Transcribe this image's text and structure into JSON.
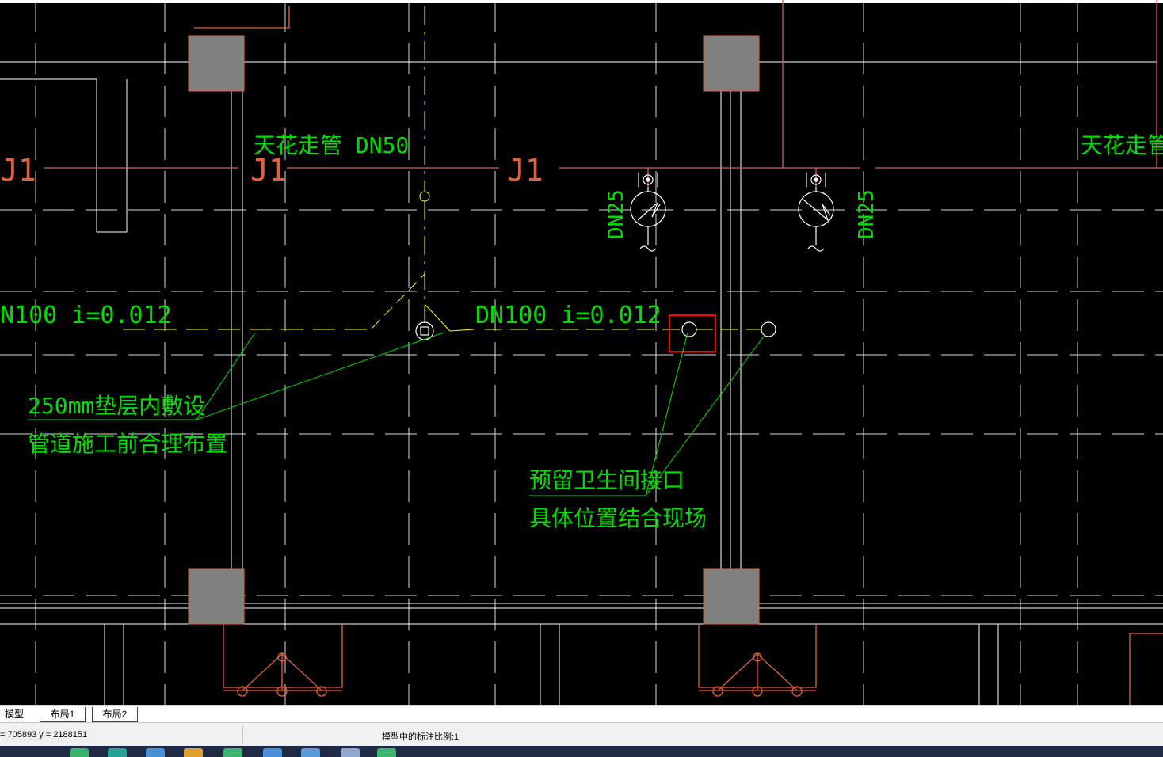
{
  "drawing": {
    "labels": {
      "ceiling_pipe_1": "天花走管 DN50",
      "ceiling_pipe_2": "天花走管 D",
      "j1_a": "J1",
      "j1_b": "J1",
      "j1_c": "J1",
      "dn25_a": "DN25",
      "dn25_b": "DN25",
      "slope_left": "N100 i=0.012",
      "slope_right": "DN100 i=0.012",
      "note_left_1": "250mm垫层内敷设",
      "note_left_2": "管道施工前合理布置",
      "note_right_1": "预留卫生间接口",
      "note_right_2": "具体位置结合现场"
    },
    "colors": {
      "background": "#000000",
      "grid": "#ffffff",
      "pipe_orange": "#e0623a",
      "text_green": "#00e000",
      "dashed_yellow": "#ffff00",
      "column_fill": "#808080",
      "highlight_red": "#ff0000"
    }
  },
  "tabs": {
    "model": "模型",
    "layout1": "布局1",
    "layout2": "布局2"
  },
  "status": {
    "coords": "= 705893 y = 2188151",
    "scale": "模型中的标注比例:1"
  }
}
